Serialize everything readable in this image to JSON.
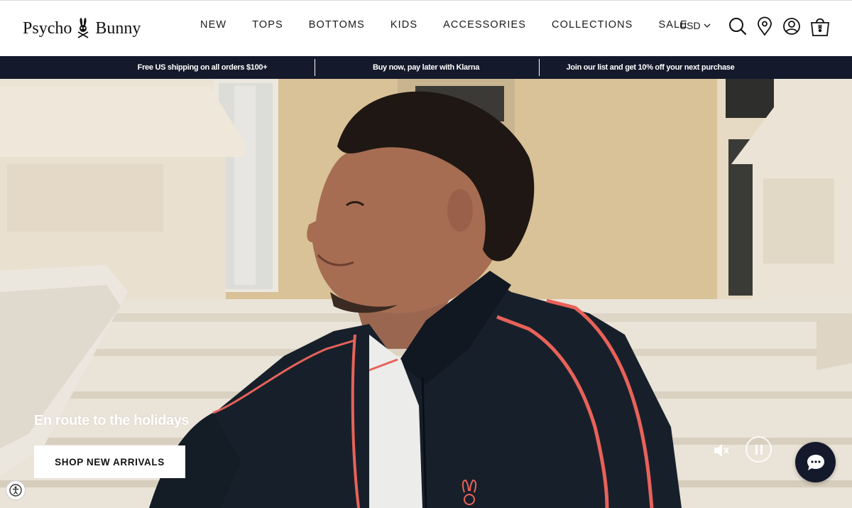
{
  "header": {
    "logo_text_left": "Psycho",
    "logo_text_right": "Bunny",
    "nav": [
      "NEW",
      "TOPS",
      "BOTTOMS",
      "KIDS",
      "ACCESSORIES",
      "COLLECTIONS",
      "SALE"
    ],
    "currency": "USD",
    "icons": [
      "search-icon",
      "store-locator-icon",
      "account-icon",
      "cart-icon"
    ]
  },
  "promo_bar": {
    "items": [
      "Free US shipping on all orders $100+",
      "Buy now, pay later with Klarna",
      "Join our list and get 10% off your next purchase"
    ],
    "background": "#141a2b"
  },
  "hero": {
    "heading": "En route to the holidays",
    "cta": "SHOP NEW ARRIVALS",
    "controls": [
      "mute-icon",
      "pause-icon"
    ]
  },
  "widgets": {
    "chat": "chat-icon",
    "accessibility": "accessibility-icon"
  },
  "colors": {
    "navy": "#141a2b",
    "jacket": "#17202a",
    "piping": "#e8625a",
    "wall": "#dcc49c",
    "stone": "#e7dfd2"
  }
}
